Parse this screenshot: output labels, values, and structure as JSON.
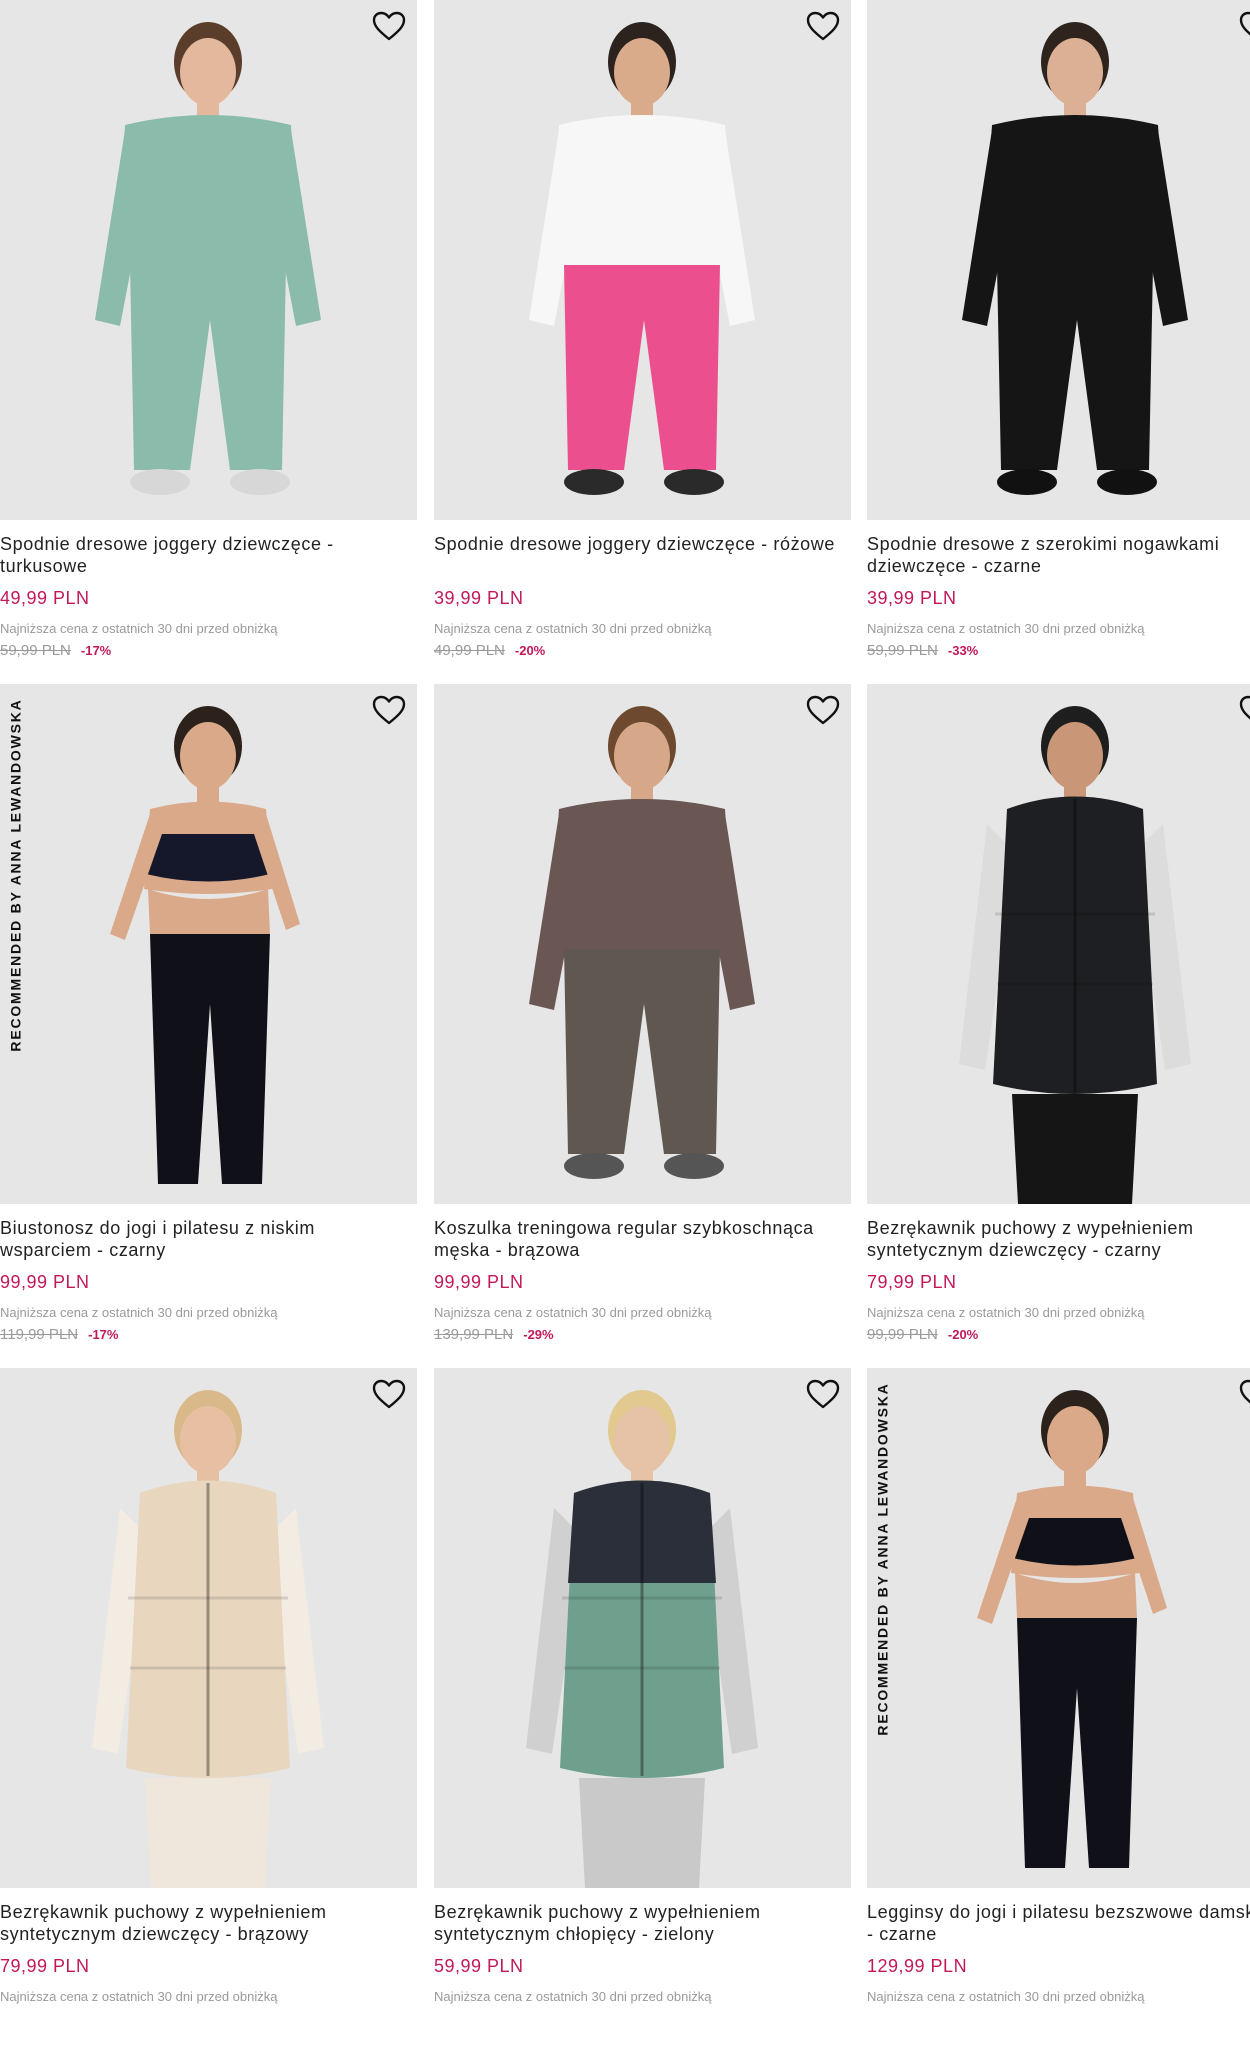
{
  "products": [
    {
      "name": "Spodnie dresowe joggery dziewczęce - turkusowe",
      "price": "49,99 PLN",
      "lowest_note": "Najniższa cena z ostatnich 30 dni przed obniżką",
      "old_price": "59,99 PLN",
      "discount": "-17%",
      "badge": "",
      "icon": "heart-icon",
      "palette": {
        "top": "#8bbcab",
        "bottom": "#8bbcab",
        "skin": "#e3b89d",
        "hair": "#5a3d2b",
        "shoe": "#d7d7d7"
      }
    },
    {
      "name": "Spodnie dresowe joggery dziewczęce - różowe",
      "price": "39,99 PLN",
      "lowest_note": "Najniższa cena z ostatnich 30 dni przed obniżką",
      "old_price": "49,99 PLN",
      "discount": "-20%",
      "badge": "",
      "icon": "heart-icon",
      "palette": {
        "top": "#f7f7f7",
        "bottom": "#ec4f8e",
        "skin": "#d9ab8b",
        "hair": "#2c231e",
        "shoe": "#2a2a2a"
      }
    },
    {
      "name": "Spodnie dresowe z szerokimi nogawkami dziewczęce - czarne",
      "price": "39,99 PLN",
      "lowest_note": "Najniższa cena z ostatnich 30 dni przed obniżką",
      "old_price": "59,99 PLN",
      "discount": "-33%",
      "badge": "",
      "icon": "heart-icon",
      "palette": {
        "top": "#151515",
        "bottom": "#151515",
        "skin": "#dcb094",
        "hair": "#2e241d",
        "shoe": "#111111"
      }
    },
    {
      "name": "Biustonosz do jogi i pilatesu z niskim wsparciem - czarny",
      "price": "99,99 PLN",
      "lowest_note": "Najniższa cena z ostatnich 30 dni przed obniżką",
      "old_price": "119,99 PLN",
      "discount": "-17%",
      "badge": "RECOMMENDED BY ANNA LEWANDOWSKA",
      "icon": "heart-icon",
      "palette": {
        "top": "#15182a",
        "bottom": "#0f1018",
        "skin": "#d9a98a",
        "hair": "#2d211b",
        "shoe": "#111111"
      }
    },
    {
      "name": "Koszulka treningowa regular szybkoschnąca męska - brązowa",
      "price": "99,99 PLN",
      "lowest_note": "Najniższa cena z ostatnich 30 dni przed obniżką",
      "old_price": "139,99 PLN",
      "discount": "-29%",
      "badge": "",
      "icon": "heart-icon",
      "palette": {
        "top": "#6a5653",
        "bottom": "#5f5750",
        "skin": "#d7a78a",
        "hair": "#6d4a2f",
        "shoe": "#555555"
      }
    },
    {
      "name": "Bezrękawnik puchowy z wypełnieniem syntetycznym dziewczęcy - czarny",
      "price": "79,99 PLN",
      "lowest_note": "Najniższa cena z ostatnich 30 dni przed obniżką",
      "old_price": "99,99 PLN",
      "discount": "-20%",
      "badge": "",
      "icon": "heart-icon",
      "palette": {
        "top": "#1d1f22",
        "bottom": "#151515",
        "skin": "#c99777",
        "hair": "#1e1e1e",
        "shoe": "#111111"
      }
    },
    {
      "name": "Bezrękawnik puchowy z wypełnieniem syntetycznym dziewczęcy - brązowy",
      "price": "79,99 PLN",
      "lowest_note": "Najniższa cena z ostatnich 30 dni przed obniżką",
      "old_price": "",
      "discount": "",
      "badge": "",
      "icon": "heart-icon",
      "palette": {
        "top": "#e8d6bf",
        "bottom": "#efe7dc",
        "skin": "#e7c0a4",
        "hair": "#d9b98a",
        "shoe": "#dddddd"
      }
    },
    {
      "name": "Bezrękawnik puchowy z wypełnieniem syntetycznym chłopięcy - zielony",
      "price": "59,99 PLN",
      "lowest_note": "Najniższa cena z ostatnich 30 dni przed obniżką",
      "old_price": "",
      "discount": "",
      "badge": "",
      "icon": "heart-icon",
      "palette": {
        "top": "#6fa08e",
        "bottom": "#c9c9c9",
        "skin": "#e6c2a6",
        "hair": "#e2c98f",
        "shoe": "#cccccc"
      }
    },
    {
      "name": "Legginsy do jogi i pilatesu bezszwowe damskie - czarne",
      "price": "129,99 PLN",
      "lowest_note": "Najniższa cena z ostatnich 30 dni przed obniżką",
      "old_price": "",
      "discount": "",
      "badge": "RECOMMENDED BY ANNA LEWANDOWSKA",
      "icon": "heart-icon",
      "palette": {
        "top": "#0f1018",
        "bottom": "#0f1018",
        "skin": "#d9a98a",
        "hair": "#2d211b",
        "shoe": "#d9a98a"
      }
    }
  ]
}
